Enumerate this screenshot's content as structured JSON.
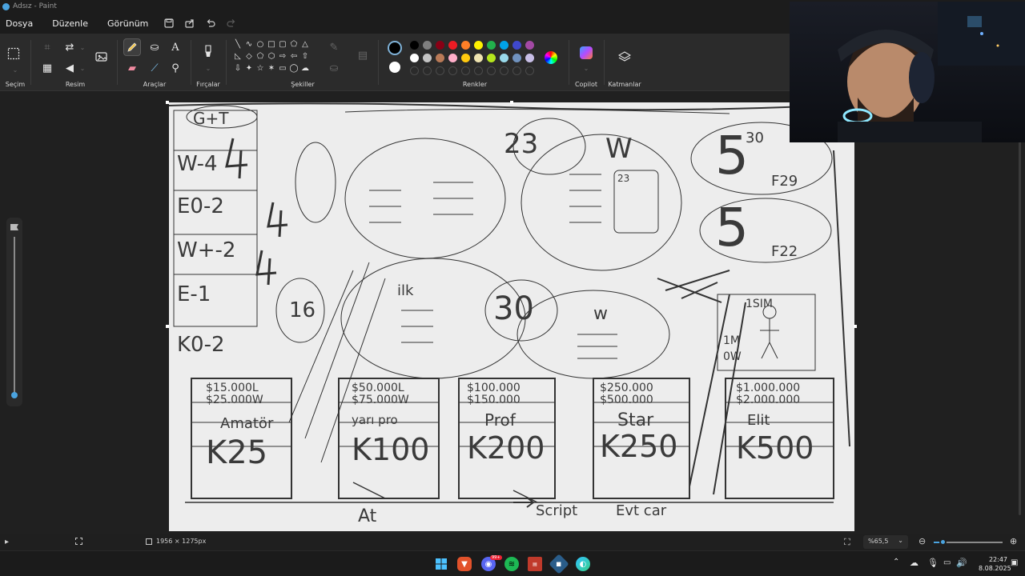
{
  "window": {
    "title": "Adsız - Paint"
  },
  "menu": {
    "file": "Dosya",
    "edit": "Düzenle",
    "view": "Görünüm"
  },
  "ribbon": {
    "groups": {
      "selection": "Seçim",
      "image": "Resim",
      "tools": "Araçlar",
      "brushes": "Fırçalar",
      "shapes": "Şekiller",
      "colors": "Renkler",
      "copilot": "Copilot",
      "layers": "Katmanlar"
    },
    "palette": {
      "row1": [
        "#000000",
        "#7f7f7f",
        "#880015",
        "#ed1c24",
        "#ff7f27",
        "#fff200",
        "#22b14c",
        "#00a2e8",
        "#3f48cc",
        "#a349a4"
      ],
      "row2": [
        "#ffffff",
        "#c3c3c3",
        "#b97a57",
        "#ffaec9",
        "#ffc90e",
        "#efe4b0",
        "#b5e61d",
        "#99d9ea",
        "#7092be",
        "#c8bfe7"
      ],
      "primary": "#000000",
      "secondary": "#ffffff"
    }
  },
  "canvas": {
    "labels": {
      "score_a": "30",
      "score_b": "23",
      "score_c": "16",
      "score_d": "30",
      "five_a": "5",
      "five_b": "5",
      "f29": "F29",
      "f22": "F22",
      "mini_23": "23",
      "mini_w": "w",
      "one_sim": "1SIM",
      "one_m": "1M",
      "one_w": "0W",
      "ilk": "ilk",
      "w_top": "W",
      "w_mid": "w",
      "tier_cards": [
        {
          "price1": "$15.000L",
          "price2": "$25.000W",
          "name": "Amatör",
          "cost": "K25"
        },
        {
          "price1": "$50.000L",
          "price2": "$75.000W",
          "name": "yarı pro",
          "cost": "K100"
        },
        {
          "price1": "$100.000",
          "price2": "$150.000",
          "name": "Prof",
          "cost": "K200"
        },
        {
          "price1": "$250.000",
          "price2": "$500.000",
          "name": "Star",
          "cost": "K250"
        },
        {
          "price1": "$1.000.000",
          "price2": "$2.000.000",
          "name": "Elit",
          "cost": "K500"
        }
      ],
      "bottom_at": "At",
      "bottom_script": "Script",
      "bottom_ev": "Evt car",
      "side_rows": [
        "G+T",
        "W-4",
        "E0-2",
        "W+-2",
        "E-1",
        "K0-2"
      ]
    }
  },
  "status": {
    "canvas_size": "1956 × 1275px",
    "zoom": "%65,5"
  },
  "taskbar": {
    "time": "22:47",
    "date": "8.08.2025",
    "badge": "99+"
  }
}
